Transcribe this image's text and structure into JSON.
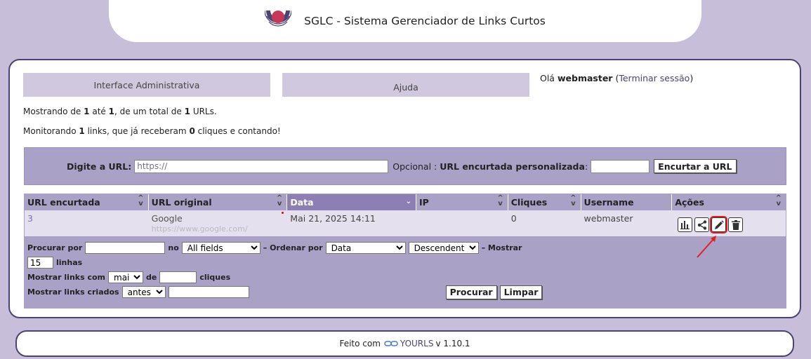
{
  "header": {
    "title": "SGLC - Sistema Gerenciador de Links Curtos"
  },
  "nav": {
    "admin_tab": "Interface Administrativa",
    "help_tab": "Ajuda",
    "greeting_prefix": "Olá",
    "username": "webmaster",
    "logout": "Terminar sessão"
  },
  "info": {
    "showing_prefix": "Mostrando de",
    "showing_from": "1",
    "showing_mid": "até",
    "showing_to": "1",
    "showing_mid2": ", de um total de",
    "showing_total": "1",
    "showing_suffix": "URLs.",
    "monitor_prefix": "Monitorando",
    "monitor_links": "1",
    "monitor_mid": "links, que já receberam",
    "monitor_clicks": "0",
    "monitor_suffix": "cliques e contando!"
  },
  "new_url": {
    "label": "Digite a URL",
    "colon": ":",
    "url_placeholder": "https://",
    "optional": "Opcional",
    "custom_label": "URL encurtada personalizada",
    "button": "Encurtar a URL"
  },
  "table": {
    "columns": [
      "URL encurtada",
      "URL original",
      "Data",
      "IP",
      "Cliques",
      "Username",
      "Ações"
    ],
    "rows": [
      {
        "short": "3",
        "title": "Google",
        "url": "https://www.google.com/",
        "date": "Mai 21, 2025 14:11",
        "ip": "",
        "clicks": "0",
        "username": "webmaster"
      }
    ]
  },
  "filters": {
    "search_for": "Procurar por",
    "in": "no",
    "field_option": "All fields",
    "order_by": "– Ordenar por",
    "order_option": "Data",
    "direction_option": "Descendente",
    "show": "– Mostrar",
    "per_page": "15",
    "lines": "linhas",
    "show_links_with": "Mostrar links com",
    "compare_option": "mais",
    "of": "de",
    "clicks": "cliques",
    "show_created": "Mostrar links criados",
    "time_option": "antes",
    "search_btn": "Procurar",
    "clear_btn": "Limpar"
  },
  "footer": {
    "prefix": "Feito com",
    "link": "YOURLS",
    "version": "v 1.10.1"
  },
  "colors": {
    "background": "#c7bfd9",
    "accent": "#4c4470",
    "header_row": "#aaa1c7",
    "active_column": "#8b7fb3",
    "highlight": "#e41e1e"
  },
  "icons": [
    "logo-icon",
    "stats-icon",
    "share-icon",
    "edit-icon",
    "delete-icon",
    "yourls-link-icon",
    "sort-icon",
    "annotation-arrow"
  ]
}
